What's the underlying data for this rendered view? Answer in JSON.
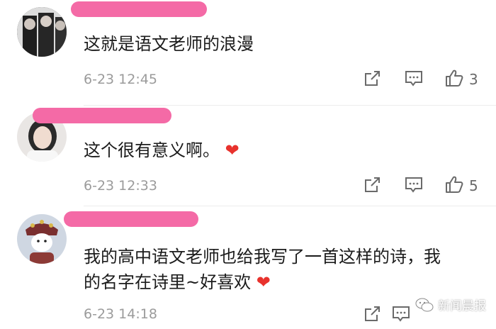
{
  "comments": [
    {
      "text": "这就是语文老师的浪漫",
      "time": "6-23 12:45",
      "likes": "3"
    },
    {
      "text": "这个很有意义啊。",
      "emoji": "❤",
      "time": "6-23 12:33",
      "likes": "5"
    },
    {
      "text_line1": "我的高中语文老师也给我写了一首这样的诗，我",
      "text_line2": "的名字在诗里~好喜欢",
      "emoji": "❤",
      "time": "6-23 14:18"
    }
  ],
  "watermark": {
    "label": "新闻晨报"
  },
  "icons": [
    "share-icon",
    "reply-icon",
    "thumbs-up-icon",
    "wechat-icon",
    "heart-emoji"
  ],
  "colors": {
    "redaction": "#f46aa6",
    "heart": "#e8322d",
    "timestamp": "#9b9b9b"
  }
}
